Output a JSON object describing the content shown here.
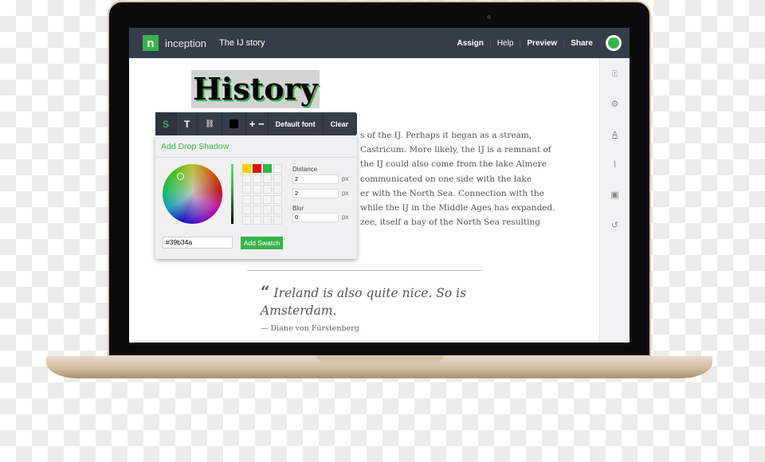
{
  "topbar": {
    "logo": "n",
    "brand": "inception",
    "doc_title": "The IJ story",
    "nav": [
      "Assign",
      "Help",
      "Preview",
      "Share"
    ]
  },
  "sidebar_icons": [
    "upload-icon",
    "gear-icon",
    "font-icon",
    "paperclip-icon",
    "document-icon",
    "history-icon"
  ],
  "article": {
    "title": "History",
    "lines": [
      "s of the IJ. Perhaps it began as a stream,",
      "Castricum. More likely, the IJ is a remnant of",
      " the IJ could also come from the lake Almere",
      " communicated on one side with the lake",
      "er with the North Sea. Connection with the",
      "while the IJ in the Middle Ages has expanded.",
      "zee, itself a bay of the North Sea resulting"
    ],
    "quote": "Ireland is also quite nice. So is Amsterdam.",
    "quote_mark": "“",
    "attribution": "—  Diane von Fürstenberg"
  },
  "toolbar": {
    "shadow_icon": "S",
    "text_icon": "T",
    "link_icon": "🔗",
    "plus": "+",
    "minus": "−",
    "font": "Default font",
    "clear": "Clear",
    "color": "#000000"
  },
  "panel": {
    "title": "Add Drop Shadow",
    "distance_label": "Distance",
    "distance_x": "2",
    "distance_y": "2",
    "blur_label": "Blur",
    "blur": "0",
    "unit": "px",
    "hex": "#39b34a",
    "add_swatch": "Add Swatch",
    "swatches": [
      "#ffd000",
      "#e01010",
      "#39b34a"
    ]
  },
  "colors": {
    "accent": "#39b34a",
    "topbar": "#373c4b"
  }
}
